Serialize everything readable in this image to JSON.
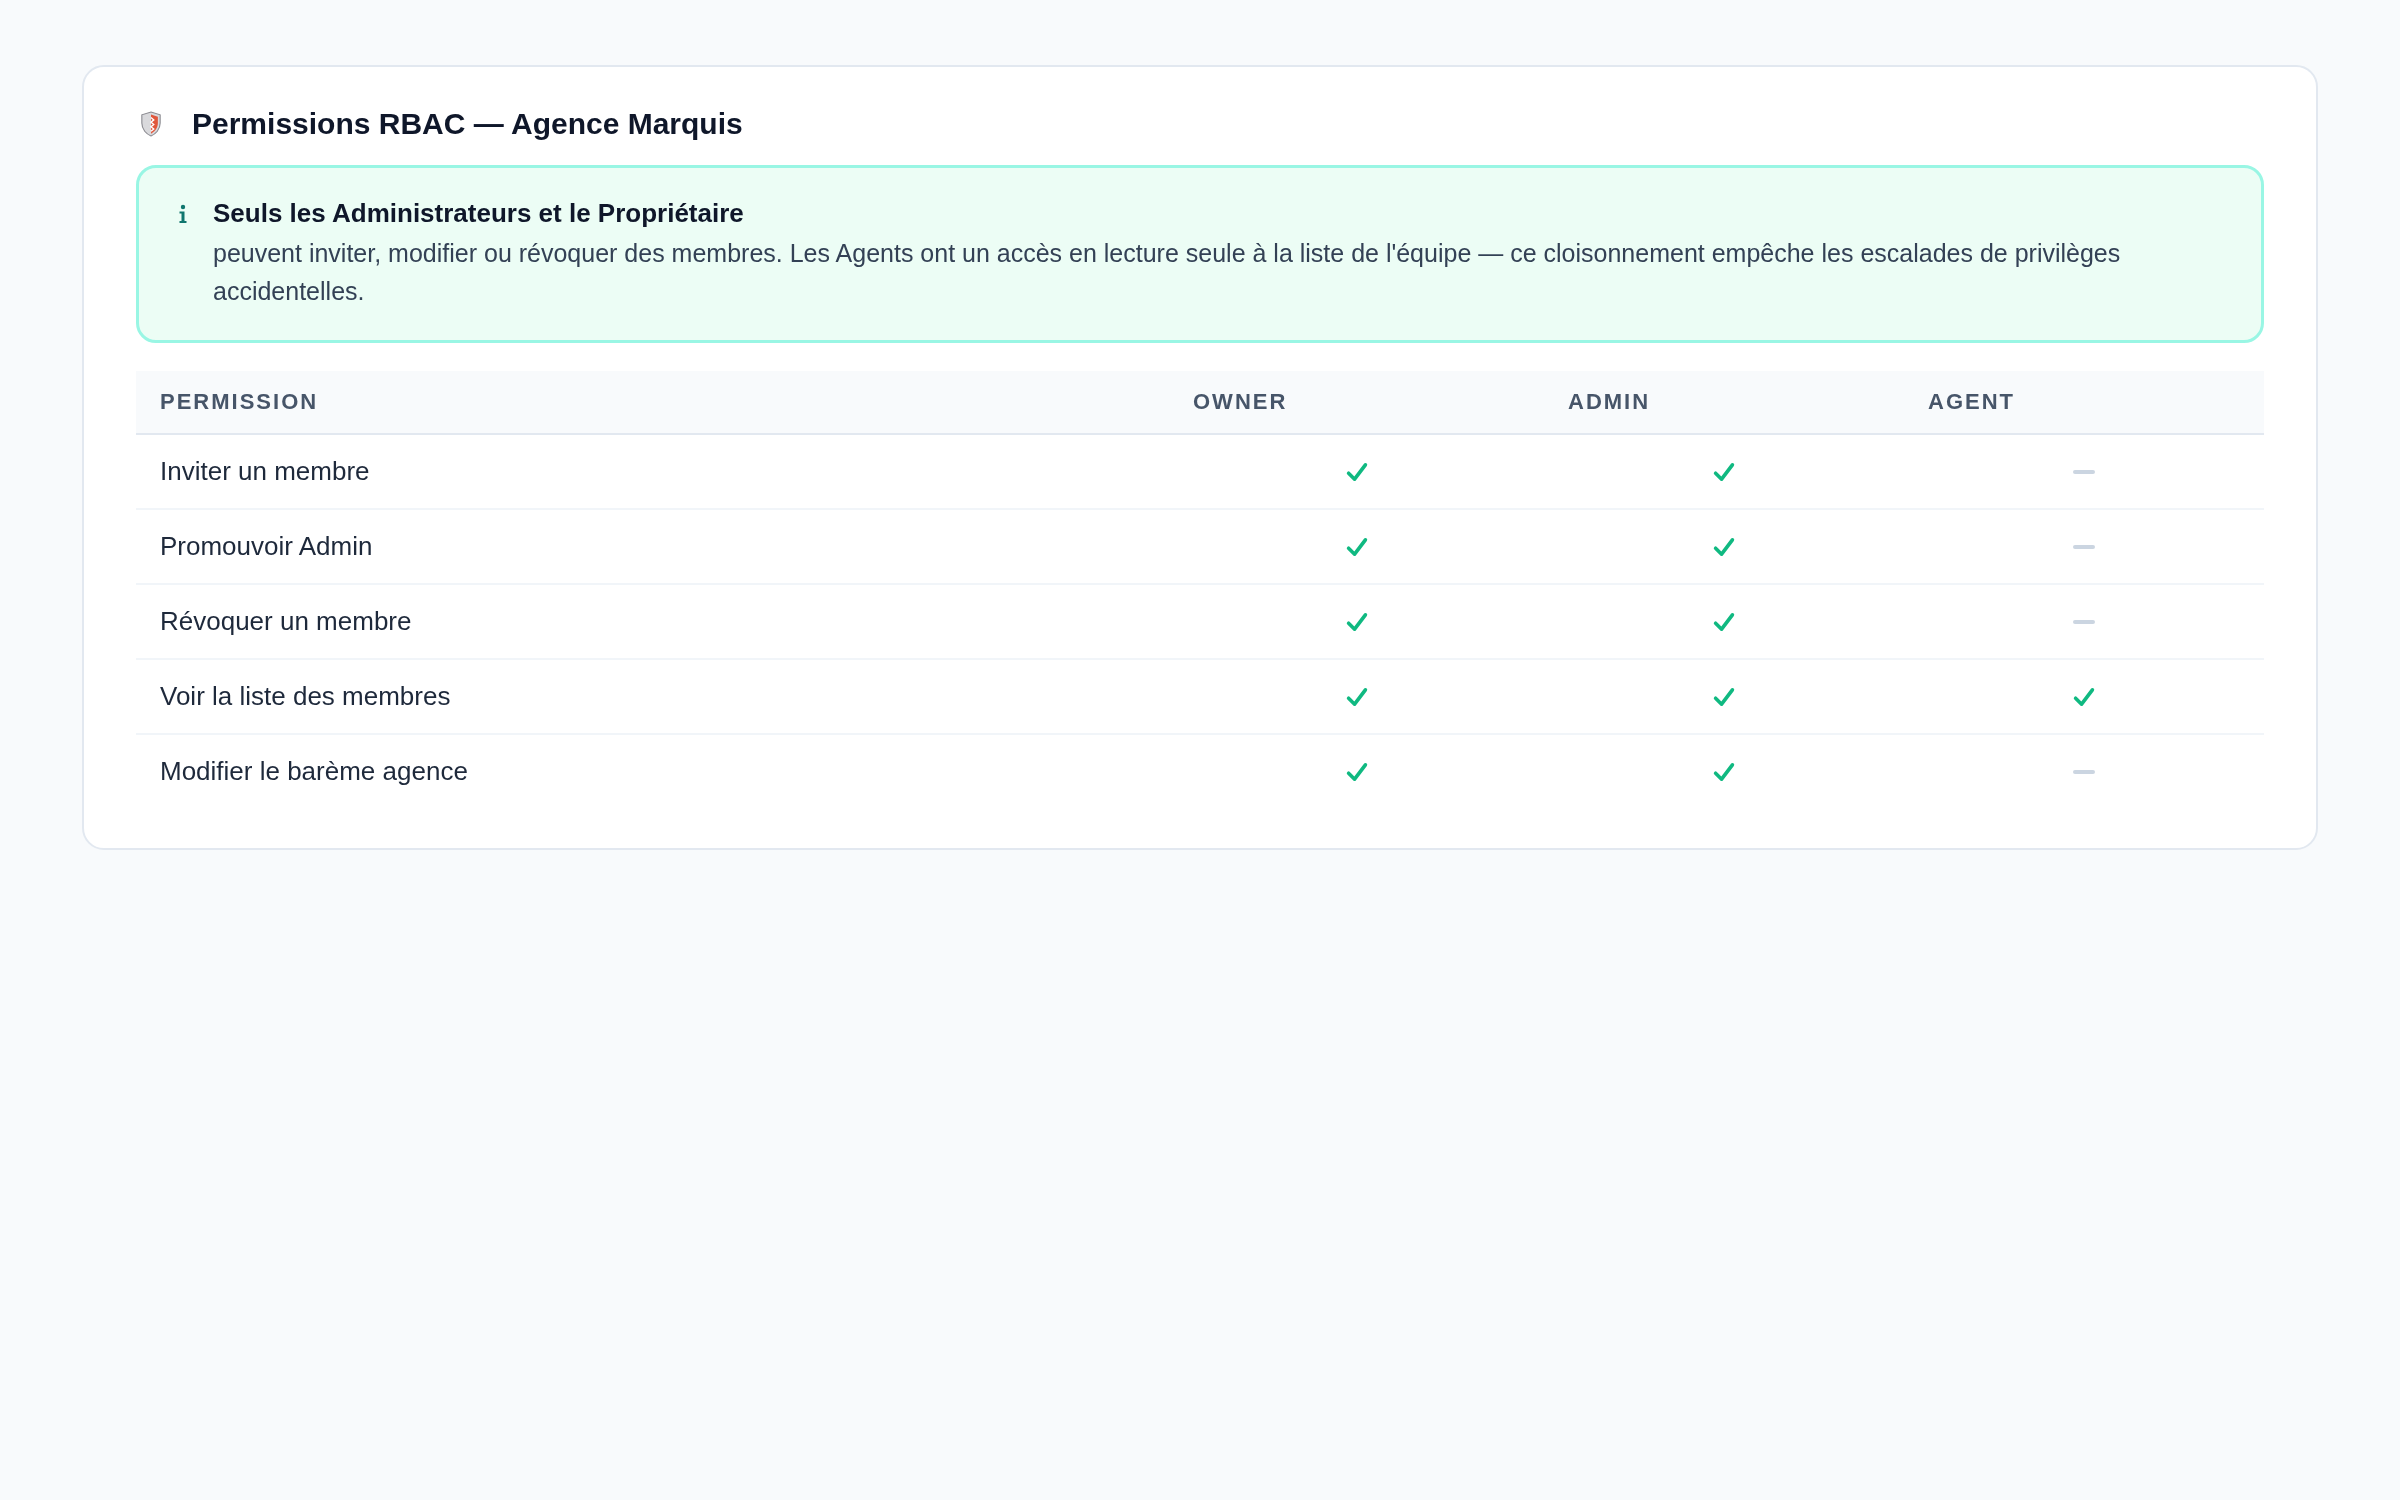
{
  "card": {
    "title": "Permissions RBAC — Agence Marquis"
  },
  "notice": {
    "heading": "Seuls les Administrateurs et le Propriétaire",
    "body": "peuvent inviter, modifier ou révoquer des membres. Les Agents ont un accès en lecture seule à la liste de l'équipe — ce cloisonnement empêche les escalades de privilèges accidentelles."
  },
  "table": {
    "columns": [
      "PERMISSION",
      "OWNER",
      "ADMIN",
      "AGENT"
    ],
    "rows": [
      {
        "permission": "Inviter un membre",
        "allowed": [
          true,
          true,
          false
        ]
      },
      {
        "permission": "Promouvoir Admin",
        "allowed": [
          true,
          true,
          false
        ]
      },
      {
        "permission": "Révoquer un membre",
        "allowed": [
          true,
          true,
          false
        ]
      },
      {
        "permission": "Voir la liste des membres",
        "allowed": [
          true,
          true,
          true
        ]
      },
      {
        "permission": "Modifier le barème agence",
        "allowed": [
          true,
          true,
          false
        ]
      }
    ]
  }
}
